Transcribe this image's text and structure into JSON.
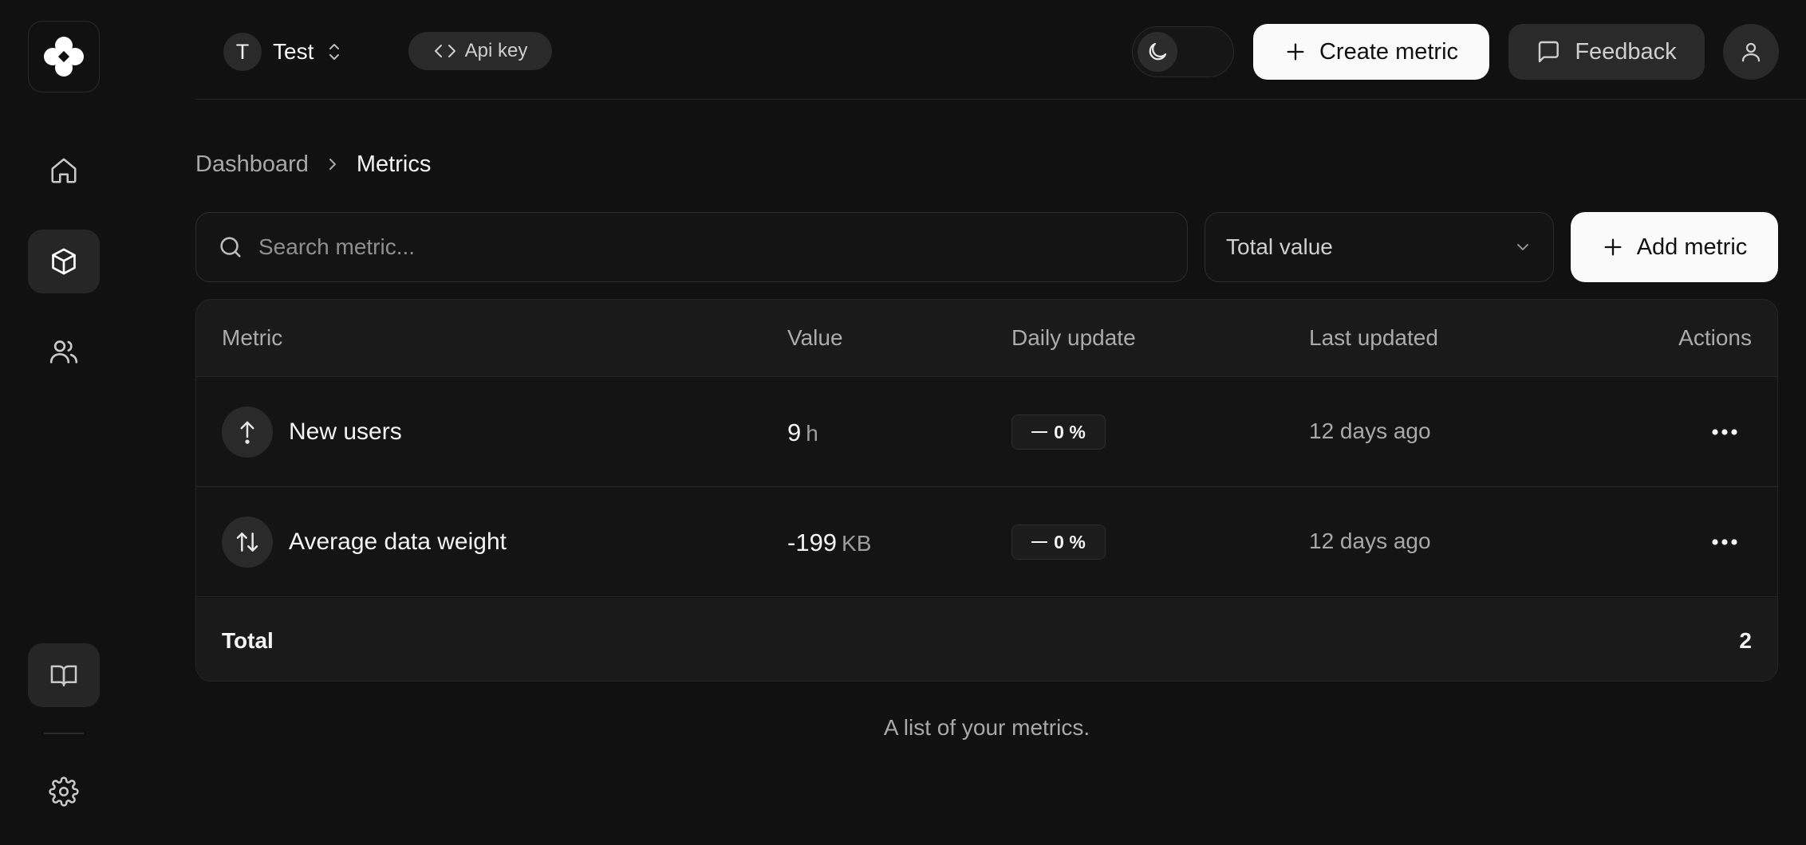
{
  "header": {
    "project": {
      "initial": "T",
      "name": "Test"
    },
    "api_key_label": "Api key",
    "create_metric_label": "Create metric",
    "feedback_label": "Feedback"
  },
  "sidebar": {
    "items": [
      {
        "name": "home",
        "icon": "home-icon",
        "active": false
      },
      {
        "name": "metrics",
        "icon": "cube-icon",
        "active": true
      },
      {
        "name": "team",
        "icon": "users-icon",
        "active": false
      },
      {
        "name": "docs",
        "icon": "book-icon",
        "active": true
      },
      {
        "name": "settings",
        "icon": "gear-icon",
        "active": false
      }
    ]
  },
  "breadcrumb": {
    "parent": "Dashboard",
    "current": "Metrics"
  },
  "toolbar": {
    "search_placeholder": "Search metric...",
    "search_value": "",
    "sort_selected": "Total value",
    "add_metric_label": "Add metric"
  },
  "table": {
    "headers": {
      "metric": "Metric",
      "value": "Value",
      "daily_update": "Daily update",
      "last_updated": "Last updated",
      "actions": "Actions"
    },
    "rows": [
      {
        "icon": "arrow-up-icon",
        "name": "New users",
        "value": "9",
        "unit": "h",
        "daily_update": "0 %",
        "last_updated": "12 days ago"
      },
      {
        "icon": "arrows-up-down-icon",
        "name": "Average data weight",
        "value": "-199",
        "unit": "KB",
        "daily_update": "0 %",
        "last_updated": "12 days ago"
      }
    ],
    "total_label": "Total",
    "total_value": "2"
  },
  "caption": "A list of your metrics.",
  "colors": {
    "background": "#111111",
    "surface": "#141414",
    "muted_surface": "#2a2a2a",
    "border": "#262626",
    "primary_button": "#fafafa"
  }
}
